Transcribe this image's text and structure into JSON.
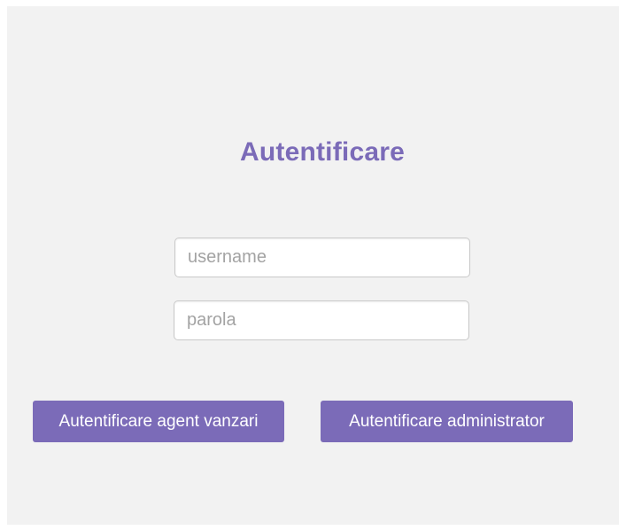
{
  "login": {
    "title": "Autentificare",
    "username": {
      "value": "",
      "placeholder": "username"
    },
    "password": {
      "value": "",
      "placeholder": "parola"
    },
    "buttons": {
      "agent_label": "Autentificare agent vanzari",
      "admin_label": "Autentificare administrator"
    }
  },
  "colors": {
    "accent": "#7b6bb8",
    "panel_background": "#f2f2f2",
    "button_text": "#ffffff"
  }
}
